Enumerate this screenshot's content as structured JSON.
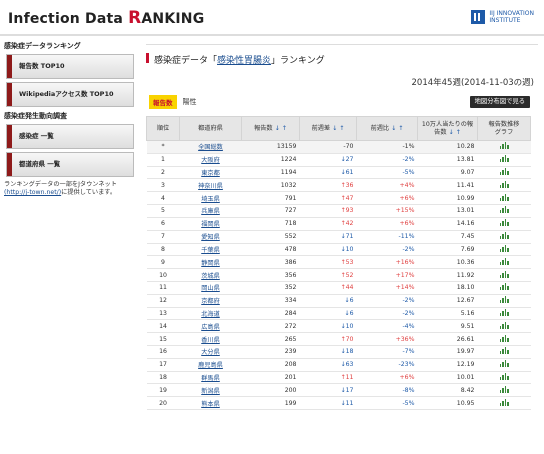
{
  "header": {
    "logo_pre": "Infection Data ",
    "logo_r": "R",
    "logo_post": "ANKING",
    "iij_line1": "IIJ INNOVATION",
    "iij_line2": "INSTITUTE"
  },
  "sidebar": {
    "section1_title": "感染症データランキング",
    "btn_reports": "報告数 TOP10",
    "btn_wikipedia": "Wikipediaアクセス数 TOP10",
    "section2_title": "感染症発生動向調査",
    "btn_disease_list": "感染症 一覧",
    "btn_pref_list": "都道府県 一覧",
    "note_line1": "ランキングデータの一部をJタウンネット",
    "note_link": "(http://j-town.net/)",
    "note_line2": "に提供しています。"
  },
  "main": {
    "title_prefix": "感染症データ「",
    "disease": "感染性胃腸炎",
    "title_suffix": "」ランキング",
    "week": "2014年45週(2014-11-03の週)",
    "tab_active": "報告数",
    "tab_other": "陽性",
    "map_button": "地図分布図で見る"
  },
  "table": {
    "headers": {
      "rank": "順位",
      "pref": "都道府県",
      "count": "報告数",
      "prev_diff": "前週差",
      "prev_ratio": "前週比",
      "per100k_1": "10万人当たりの報",
      "per100k_2": "告数",
      "graph_1": "報告数推移",
      "graph_2": "グラフ"
    },
    "summary": {
      "rank": "*",
      "pref": "全国総数",
      "count": "13159",
      "diff": "-70",
      "ratio": "-1%",
      "per": "10.28"
    },
    "rows": [
      {
        "rank": "1",
        "pref": "大阪府",
        "count": "1224",
        "diff": "27",
        "dir": "down",
        "ratio": "-2%",
        "per": "13.81"
      },
      {
        "rank": "2",
        "pref": "東京都",
        "count": "1194",
        "diff": "61",
        "dir": "down",
        "ratio": "-5%",
        "per": "9.07"
      },
      {
        "rank": "3",
        "pref": "神奈川県",
        "count": "1032",
        "diff": "36",
        "dir": "up",
        "ratio": "+4%",
        "per": "11.41"
      },
      {
        "rank": "4",
        "pref": "埼玉県",
        "count": "791",
        "diff": "47",
        "dir": "up",
        "ratio": "+6%",
        "per": "10.99"
      },
      {
        "rank": "5",
        "pref": "兵庫県",
        "count": "727",
        "diff": "93",
        "dir": "up",
        "ratio": "+15%",
        "per": "13.01"
      },
      {
        "rank": "6",
        "pref": "福岡県",
        "count": "718",
        "diff": "42",
        "dir": "up",
        "ratio": "+6%",
        "per": "14.16"
      },
      {
        "rank": "7",
        "pref": "愛知県",
        "count": "552",
        "diff": "71",
        "dir": "down",
        "ratio": "-11%",
        "per": "7.45"
      },
      {
        "rank": "8",
        "pref": "千葉県",
        "count": "478",
        "diff": "10",
        "dir": "down",
        "ratio": "-2%",
        "per": "7.69"
      },
      {
        "rank": "9",
        "pref": "静岡県",
        "count": "386",
        "diff": "53",
        "dir": "up",
        "ratio": "+16%",
        "per": "10.36"
      },
      {
        "rank": "10",
        "pref": "茨城県",
        "count": "356",
        "diff": "52",
        "dir": "up",
        "ratio": "+17%",
        "per": "11.92"
      },
      {
        "rank": "11",
        "pref": "岡山県",
        "count": "352",
        "diff": "44",
        "dir": "up",
        "ratio": "+14%",
        "per": "18.10"
      },
      {
        "rank": "12",
        "pref": "京都府",
        "count": "334",
        "diff": "6",
        "dir": "down",
        "ratio": "-2%",
        "per": "12.67"
      },
      {
        "rank": "13",
        "pref": "北海道",
        "count": "284",
        "diff": "6",
        "dir": "down",
        "ratio": "-2%",
        "per": "5.16"
      },
      {
        "rank": "14",
        "pref": "広島県",
        "count": "272",
        "diff": "10",
        "dir": "down",
        "ratio": "-4%",
        "per": "9.51"
      },
      {
        "rank": "15",
        "pref": "香川県",
        "count": "265",
        "diff": "70",
        "dir": "up",
        "ratio": "+36%",
        "per": "26.61"
      },
      {
        "rank": "16",
        "pref": "大分県",
        "count": "239",
        "diff": "18",
        "dir": "down",
        "ratio": "-7%",
        "per": "19.97"
      },
      {
        "rank": "17",
        "pref": "鹿児島県",
        "count": "208",
        "diff": "63",
        "dir": "down",
        "ratio": "-23%",
        "per": "12.19"
      },
      {
        "rank": "18",
        "pref": "群馬県",
        "count": "201",
        "diff": "11",
        "dir": "up",
        "ratio": "+6%",
        "per": "10.01"
      },
      {
        "rank": "19",
        "pref": "新潟県",
        "count": "200",
        "diff": "17",
        "dir": "down",
        "ratio": "-8%",
        "per": "8.42"
      },
      {
        "rank": "20",
        "pref": "熊本県",
        "count": "199",
        "diff": "11",
        "dir": "down",
        "ratio": "-5%",
        "per": "10.95"
      }
    ]
  },
  "icons": {
    "sort": "sort-arrows-icon",
    "graph": "bar-chart-icon",
    "arrow_up": "arrow-up-icon",
    "arrow_down": "arrow-down-icon"
  },
  "colors": {
    "brand_red": "#c8102e",
    "link_blue": "#1a4d8f",
    "up": "#e04040",
    "down": "#1e5aa8",
    "tab_yellow": "#f9d300"
  }
}
